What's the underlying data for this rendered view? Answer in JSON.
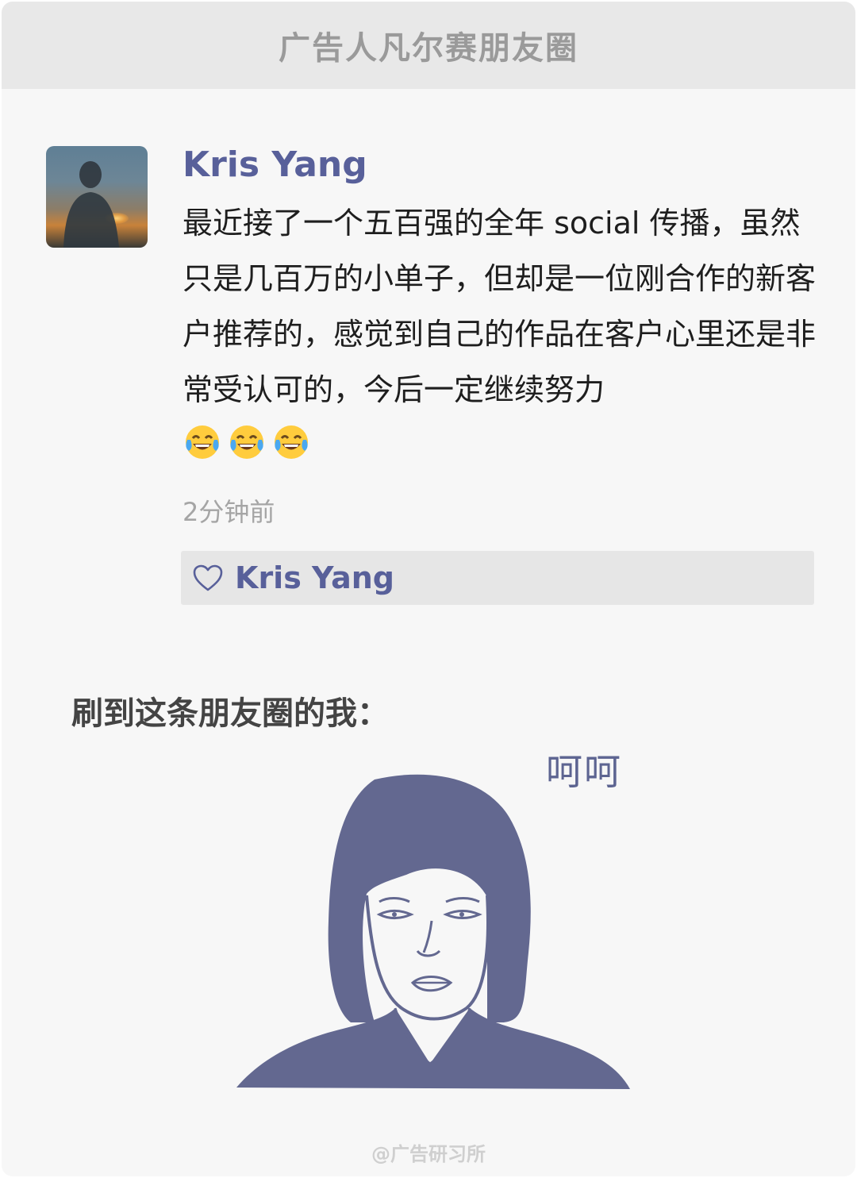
{
  "header": {
    "title": "广告人凡尔赛朋友圈"
  },
  "post": {
    "author": "Kris Yang",
    "text": "最近接了一个五百强的全年 social 传播，虽然只是几百万的小单子，但却是一位刚合作的新客户推荐的，感觉到自己的作品在客户心里还是非常受认可的，今后一定继续努力",
    "emojis": [
      "face-with-tears-of-joy",
      "face-with-tears-of-joy",
      "face-with-tears-of-joy"
    ],
    "time": "2分钟前",
    "likes": {
      "icon": "heart-outline-icon",
      "names": "Kris Yang"
    }
  },
  "reaction": {
    "caption": "刷到这条朋友圈的我：",
    "bubble_text": "呵呵",
    "image": "deadpan-face-illustration"
  },
  "watermark": "@广告研习所",
  "colors": {
    "name_color": "#58609a",
    "illustration": "#636890",
    "card_bg": "#f7f7f7",
    "header_bg": "#e8e8e8"
  }
}
